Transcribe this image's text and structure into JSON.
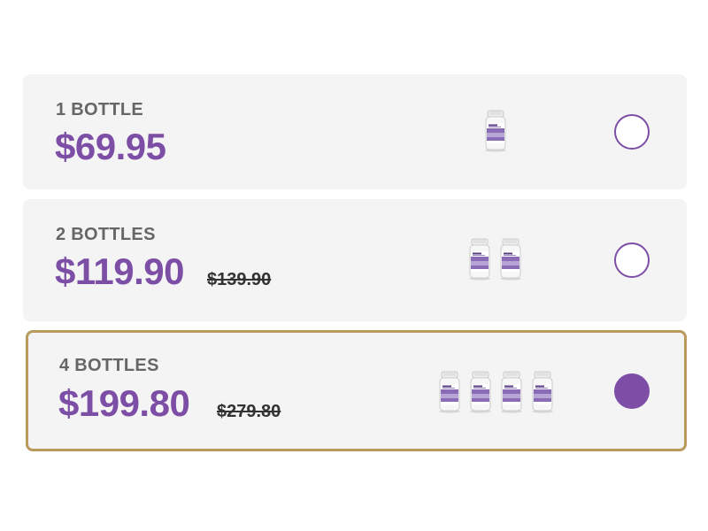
{
  "options": [
    {
      "quantity_label": "1 BOTTLE",
      "price": "$69.95",
      "original_price": "",
      "bottle_count": 1,
      "selected": false
    },
    {
      "quantity_label": "2 BOTTLES",
      "price": "$119.90",
      "original_price": "$139.90",
      "bottle_count": 2,
      "selected": false
    },
    {
      "quantity_label": "4 BOTTLES",
      "price": "$199.80",
      "original_price": "$279.80",
      "bottle_count": 4,
      "selected": true
    }
  ],
  "colors": {
    "accent": "#7d4ea5",
    "selected_border": "#b89a5c",
    "card_background": "#f4f4f4"
  },
  "icons": {
    "product": "supplement-bottle-icon",
    "radio_unchecked": "radio-unchecked",
    "radio_checked": "radio-checked"
  }
}
